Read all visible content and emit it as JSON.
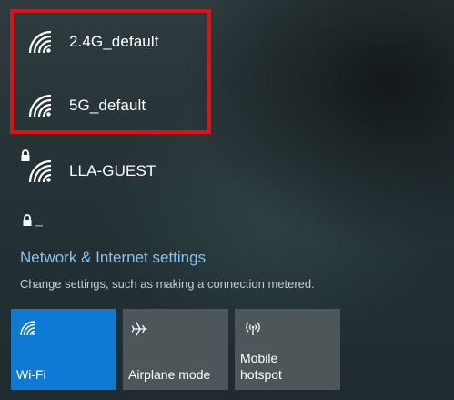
{
  "networks": [
    {
      "name": "2.4G_default",
      "secured": false,
      "icon": "wifi-signal-icon"
    },
    {
      "name": "5G_default",
      "secured": false,
      "icon": "wifi-signal-icon"
    },
    {
      "name": "LLA-GUEST",
      "secured": true,
      "icon": "wifi-secured-icon"
    }
  ],
  "settings": {
    "link": "Network & Internet settings",
    "description": "Change settings, such as making a connection metered."
  },
  "quick_actions": [
    {
      "label": "Wi-Fi",
      "icon": "wifi-icon",
      "active": true
    },
    {
      "label": "Airplane mode",
      "icon": "airplane-icon",
      "active": false
    },
    {
      "label": "Mobile\nhotspot",
      "icon": "hotspot-icon",
      "active": false
    }
  ],
  "colors": {
    "highlight": "#e30f17",
    "accent": "#0f7ad4",
    "link": "#86c3f0",
    "tile_inactive": "#4d5658"
  }
}
